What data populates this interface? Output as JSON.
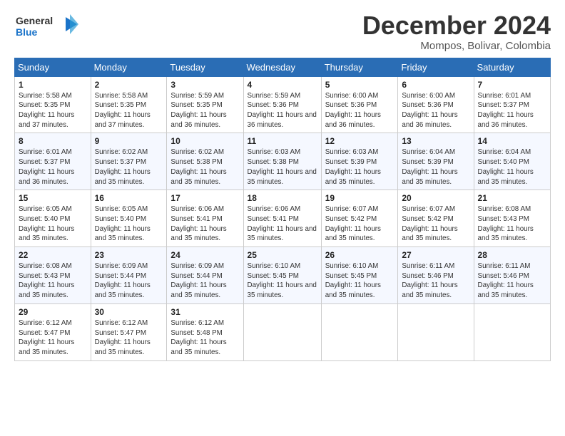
{
  "header": {
    "logo_line1": "General",
    "logo_line2": "Blue",
    "cal_title": "December 2024",
    "cal_subtitle": "Mompos, Bolivar, Colombia"
  },
  "days_of_week": [
    "Sunday",
    "Monday",
    "Tuesday",
    "Wednesday",
    "Thursday",
    "Friday",
    "Saturday"
  ],
  "weeks": [
    [
      {
        "day": "1",
        "sunrise": "5:58 AM",
        "sunset": "5:35 PM",
        "daylight": "11 hours and 37 minutes."
      },
      {
        "day": "2",
        "sunrise": "5:58 AM",
        "sunset": "5:35 PM",
        "daylight": "11 hours and 37 minutes."
      },
      {
        "day": "3",
        "sunrise": "5:59 AM",
        "sunset": "5:35 PM",
        "daylight": "11 hours and 36 minutes."
      },
      {
        "day": "4",
        "sunrise": "5:59 AM",
        "sunset": "5:36 PM",
        "daylight": "11 hours and 36 minutes."
      },
      {
        "day": "5",
        "sunrise": "6:00 AM",
        "sunset": "5:36 PM",
        "daylight": "11 hours and 36 minutes."
      },
      {
        "day": "6",
        "sunrise": "6:00 AM",
        "sunset": "5:36 PM",
        "daylight": "11 hours and 36 minutes."
      },
      {
        "day": "7",
        "sunrise": "6:01 AM",
        "sunset": "5:37 PM",
        "daylight": "11 hours and 36 minutes."
      }
    ],
    [
      {
        "day": "8",
        "sunrise": "6:01 AM",
        "sunset": "5:37 PM",
        "daylight": "11 hours and 36 minutes."
      },
      {
        "day": "9",
        "sunrise": "6:02 AM",
        "sunset": "5:37 PM",
        "daylight": "11 hours and 35 minutes."
      },
      {
        "day": "10",
        "sunrise": "6:02 AM",
        "sunset": "5:38 PM",
        "daylight": "11 hours and 35 minutes."
      },
      {
        "day": "11",
        "sunrise": "6:03 AM",
        "sunset": "5:38 PM",
        "daylight": "11 hours and 35 minutes."
      },
      {
        "day": "12",
        "sunrise": "6:03 AM",
        "sunset": "5:39 PM",
        "daylight": "11 hours and 35 minutes."
      },
      {
        "day": "13",
        "sunrise": "6:04 AM",
        "sunset": "5:39 PM",
        "daylight": "11 hours and 35 minutes."
      },
      {
        "day": "14",
        "sunrise": "6:04 AM",
        "sunset": "5:40 PM",
        "daylight": "11 hours and 35 minutes."
      }
    ],
    [
      {
        "day": "15",
        "sunrise": "6:05 AM",
        "sunset": "5:40 PM",
        "daylight": "11 hours and 35 minutes."
      },
      {
        "day": "16",
        "sunrise": "6:05 AM",
        "sunset": "5:40 PM",
        "daylight": "11 hours and 35 minutes."
      },
      {
        "day": "17",
        "sunrise": "6:06 AM",
        "sunset": "5:41 PM",
        "daylight": "11 hours and 35 minutes."
      },
      {
        "day": "18",
        "sunrise": "6:06 AM",
        "sunset": "5:41 PM",
        "daylight": "11 hours and 35 minutes."
      },
      {
        "day": "19",
        "sunrise": "6:07 AM",
        "sunset": "5:42 PM",
        "daylight": "11 hours and 35 minutes."
      },
      {
        "day": "20",
        "sunrise": "6:07 AM",
        "sunset": "5:42 PM",
        "daylight": "11 hours and 35 minutes."
      },
      {
        "day": "21",
        "sunrise": "6:08 AM",
        "sunset": "5:43 PM",
        "daylight": "11 hours and 35 minutes."
      }
    ],
    [
      {
        "day": "22",
        "sunrise": "6:08 AM",
        "sunset": "5:43 PM",
        "daylight": "11 hours and 35 minutes."
      },
      {
        "day": "23",
        "sunrise": "6:09 AM",
        "sunset": "5:44 PM",
        "daylight": "11 hours and 35 minutes."
      },
      {
        "day": "24",
        "sunrise": "6:09 AM",
        "sunset": "5:44 PM",
        "daylight": "11 hours and 35 minutes."
      },
      {
        "day": "25",
        "sunrise": "6:10 AM",
        "sunset": "5:45 PM",
        "daylight": "11 hours and 35 minutes."
      },
      {
        "day": "26",
        "sunrise": "6:10 AM",
        "sunset": "5:45 PM",
        "daylight": "11 hours and 35 minutes."
      },
      {
        "day": "27",
        "sunrise": "6:11 AM",
        "sunset": "5:46 PM",
        "daylight": "11 hours and 35 minutes."
      },
      {
        "day": "28",
        "sunrise": "6:11 AM",
        "sunset": "5:46 PM",
        "daylight": "11 hours and 35 minutes."
      }
    ],
    [
      {
        "day": "29",
        "sunrise": "6:12 AM",
        "sunset": "5:47 PM",
        "daylight": "11 hours and 35 minutes."
      },
      {
        "day": "30",
        "sunrise": "6:12 AM",
        "sunset": "5:47 PM",
        "daylight": "11 hours and 35 minutes."
      },
      {
        "day": "31",
        "sunrise": "6:12 AM",
        "sunset": "5:48 PM",
        "daylight": "11 hours and 35 minutes."
      },
      null,
      null,
      null,
      null
    ]
  ]
}
